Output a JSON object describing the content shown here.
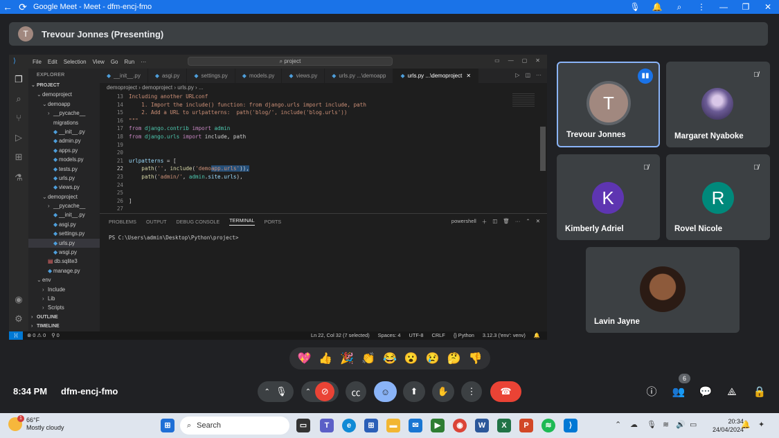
{
  "window": {
    "title": "Google Meet - Meet - dfm-encj-fmo",
    "back_icon": "arrow-left-icon",
    "reload_icon": "reload-icon"
  },
  "presenting": {
    "initial": "T",
    "label": "Trevour Jonnes (Presenting)"
  },
  "vscode": {
    "menu": [
      "File",
      "Edit",
      "Selection",
      "View",
      "Go",
      "Run",
      "···"
    ],
    "command_center": "⌕ project",
    "explorer_title": "EXPLORER",
    "tree": [
      {
        "label": "PROJECT",
        "depth": 0,
        "arrow": "⌄",
        "kind": "section"
      },
      {
        "label": "demoproject",
        "depth": 1,
        "arrow": "⌄",
        "kind": "folder"
      },
      {
        "label": "demoapp",
        "depth": 2,
        "arrow": "⌄",
        "kind": "folder"
      },
      {
        "label": "__pycache__",
        "depth": 3,
        "arrow": "›",
        "kind": "folder"
      },
      {
        "label": "migrations",
        "depth": 3,
        "arrow": "",
        "kind": "folder"
      },
      {
        "label": "__init__.py",
        "depth": 3,
        "arrow": "",
        "kind": "py"
      },
      {
        "label": "admin.py",
        "depth": 3,
        "arrow": "",
        "kind": "py"
      },
      {
        "label": "apps.py",
        "depth": 3,
        "arrow": "",
        "kind": "py"
      },
      {
        "label": "models.py",
        "depth": 3,
        "arrow": "",
        "kind": "py"
      },
      {
        "label": "tests.py",
        "depth": 3,
        "arrow": "",
        "kind": "py"
      },
      {
        "label": "urls.py",
        "depth": 3,
        "arrow": "",
        "kind": "py"
      },
      {
        "label": "views.py",
        "depth": 3,
        "arrow": "",
        "kind": "py"
      },
      {
        "label": "demoproject",
        "depth": 2,
        "arrow": "⌄",
        "kind": "folder"
      },
      {
        "label": "__pycache__",
        "depth": 3,
        "arrow": "›",
        "kind": "folder"
      },
      {
        "label": "__init__.py",
        "depth": 3,
        "arrow": "",
        "kind": "py"
      },
      {
        "label": "asgi.py",
        "depth": 3,
        "arrow": "",
        "kind": "py"
      },
      {
        "label": "settings.py",
        "depth": 3,
        "arrow": "",
        "kind": "py"
      },
      {
        "label": "urls.py",
        "depth": 3,
        "arrow": "",
        "kind": "py",
        "selected": true
      },
      {
        "label": "wsgi.py",
        "depth": 3,
        "arrow": "",
        "kind": "py"
      },
      {
        "label": "db.sqlite3",
        "depth": 2,
        "arrow": "",
        "kind": "db"
      },
      {
        "label": "manage.py",
        "depth": 2,
        "arrow": "",
        "kind": "py"
      },
      {
        "label": "env",
        "depth": 1,
        "arrow": "⌄",
        "kind": "folder"
      },
      {
        "label": "Include",
        "depth": 2,
        "arrow": "›",
        "kind": "folder"
      },
      {
        "label": "Lib",
        "depth": 2,
        "arrow": "›",
        "kind": "folder"
      },
      {
        "label": "Scripts",
        "depth": 2,
        "arrow": "›",
        "kind": "folder"
      },
      {
        "label": "OUTLINE",
        "depth": 0,
        "arrow": "›",
        "kind": "section"
      },
      {
        "label": "TIMELINE",
        "depth": 0,
        "arrow": "›",
        "kind": "section"
      }
    ],
    "tabs": [
      {
        "label": "__init__.py",
        "active": false
      },
      {
        "label": "asgi.py",
        "active": false
      },
      {
        "label": "settings.py",
        "active": false
      },
      {
        "label": "models.py",
        "active": false
      },
      {
        "label": "views.py",
        "active": false
      },
      {
        "label": "urls.py ...\\demoapp",
        "active": false
      },
      {
        "label": "urls.py ...\\demoproject",
        "active": true
      }
    ],
    "breadcrumbs": "demoproject  ›  demoproject  ›  urls.py  ›  ...",
    "lines": [
      {
        "n": "13",
        "html": "<span class=\"c-str\">Including another URLconf</span>"
      },
      {
        "n": "14",
        "html": "<span class=\"c-str\">    1. Import the include() function: from django.urls import include, path</span>"
      },
      {
        "n": "15",
        "html": "<span class=\"c-str\">    2. Add a URL to urlpatterns:  path('blog/', include('blog.urls'))</span>"
      },
      {
        "n": "16",
        "html": "<span class=\"c-str\">\"\"\"</span>"
      },
      {
        "n": "17",
        "html": "<span class=\"c-kw\">from</span> <span class=\"c-mod\">django.contrib</span> <span class=\"c-kw\">import</span> <span class=\"c-mod\">admin</span>"
      },
      {
        "n": "18",
        "html": "<span class=\"c-kw\">from</span> <span class=\"c-mod\">django.urls</span> <span class=\"c-kw\">import</span> include, path"
      },
      {
        "n": "19",
        "html": ""
      },
      {
        "n": "20",
        "html": ""
      },
      {
        "n": "21",
        "html": "<span class=\"c-var\">urlpatterns</span> = ["
      },
      {
        "n": "22",
        "html": "    <span class=\"c-fn\">path</span>(<span class=\"c-str\">''</span>, <span class=\"c-fn\">include</span>(<span class=\"c-str\">'demo</span><span class=\"c-sel\"><span class=\"c-str\">app.urls'</span>)),</span>"
      },
      {
        "n": "23",
        "html": "    <span class=\"c-fn\">path</span>(<span class=\"c-str\">'admin/'</span>, <span class=\"c-mod\">admin</span>.<span class=\"c-var\">site</span>.<span class=\"c-var\">urls</span>),"
      },
      {
        "n": "24",
        "html": ""
      },
      {
        "n": "25",
        "html": ""
      },
      {
        "n": "26",
        "html": "]"
      },
      {
        "n": "27",
        "html": ""
      }
    ],
    "panel_tabs": [
      "PROBLEMS",
      "OUTPUT",
      "DEBUG CONSOLE",
      "TERMINAL",
      "PORTS"
    ],
    "panel_active": "TERMINAL",
    "shell": "powershell",
    "terminal_prompt": "PS C:\\Users\\admin\\Desktop\\Python\\project>",
    "status_left": [
      "⊗ 0 ⚠ 0",
      "⚲ 0"
    ],
    "status_right": [
      "Ln 22, Col 32 (7 selected)",
      "Spaces: 4",
      "UTF-8",
      "CRLF",
      "{} Python",
      "3.12.3 ('env': venv)"
    ]
  },
  "participants": [
    {
      "name": "Trevour Jonnes",
      "initial": "T",
      "color": "#a1887f",
      "speaking": true
    },
    {
      "name": "Margaret Nyaboke",
      "initial": "",
      "color": "#5b4f7c",
      "muted": true
    },
    {
      "name": "Kimberly Adriel",
      "initial": "K",
      "color": "#5e35b1",
      "muted": true
    },
    {
      "name": "Rovel Nicole",
      "initial": "R",
      "color": "#00897b",
      "muted": true
    },
    {
      "name": "Lavin Jayne",
      "initial": "",
      "color": "#6d4c41",
      "muted": false
    }
  ],
  "reactions": [
    "💖",
    "👍",
    "🎉",
    "👏",
    "😂",
    "😮",
    "😢",
    "🤔",
    "👎"
  ],
  "meeting": {
    "time": "8:34 PM",
    "code": "dfm-encj-fmo",
    "people_count": "6"
  },
  "taskbar": {
    "temp": "66°F",
    "weather": "Mostly cloudy",
    "weather_badge": "1",
    "search_placeholder": "Search",
    "time": "20:34",
    "date": "24/04/2024"
  },
  "colors": {
    "meet_bg": "#202124",
    "accent_blue": "#1a73e8",
    "end_call_red": "#ea4335",
    "vscode_bg": "#1e1e1e"
  }
}
